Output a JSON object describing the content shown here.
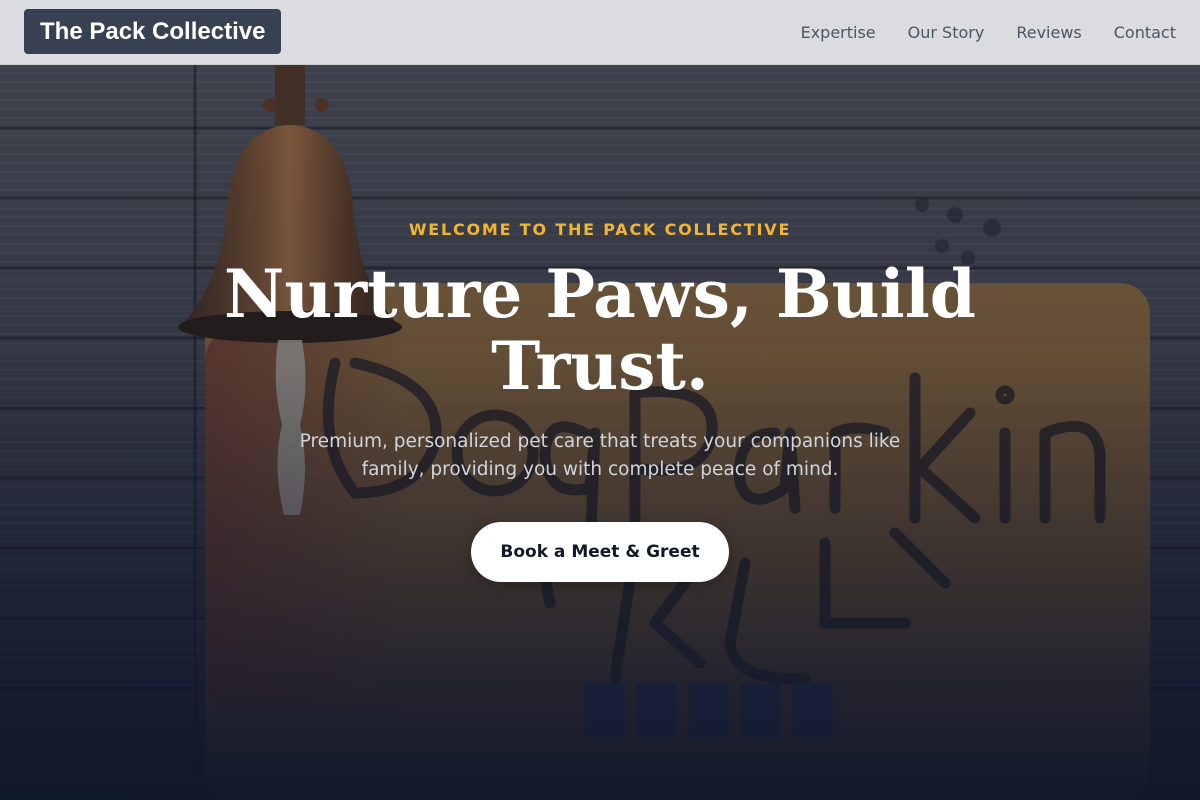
{
  "nav": {
    "logo": "The Pack Collective",
    "links": [
      "Expertise",
      "Our Story",
      "Reviews",
      "Contact"
    ]
  },
  "hero": {
    "eyebrow": "WELCOME TO THE PACK COLLECTIVE",
    "headline": "Nurture Paws, Build Trust.",
    "subtitle": "Premium, personalized pet care that treats your companions like family, providing you with complete peace of mind.",
    "cta_label": "Book a Meet & Greet",
    "background_image": {
      "sign_text": "Dog Parking",
      "sign_text_cn": "泊狗位"
    }
  },
  "colors": {
    "accent": "#f2b62e",
    "logo_bg": "#374151",
    "navbar_bg": "#e2e3e5",
    "nav_text": "#4b5563",
    "hero_overlay": "#0f172a",
    "cta_bg": "#ffffff",
    "cta_text": "#111827"
  }
}
